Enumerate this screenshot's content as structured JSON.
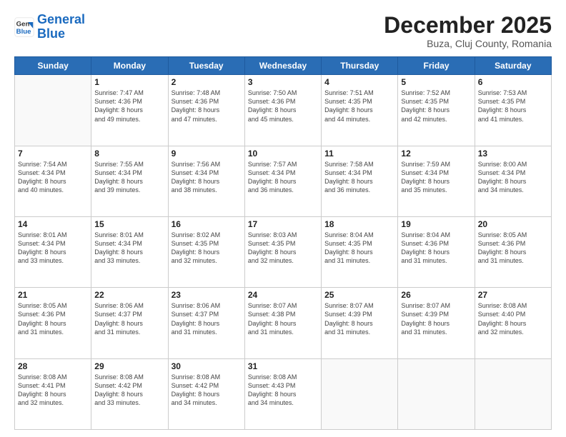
{
  "header": {
    "logo_line1": "General",
    "logo_line2": "Blue",
    "month": "December 2025",
    "location": "Buza, Cluj County, Romania"
  },
  "weekdays": [
    "Sunday",
    "Monday",
    "Tuesday",
    "Wednesday",
    "Thursday",
    "Friday",
    "Saturday"
  ],
  "weeks": [
    [
      {
        "day": "",
        "info": ""
      },
      {
        "day": "1",
        "info": "Sunrise: 7:47 AM\nSunset: 4:36 PM\nDaylight: 8 hours\nand 49 minutes."
      },
      {
        "day": "2",
        "info": "Sunrise: 7:48 AM\nSunset: 4:36 PM\nDaylight: 8 hours\nand 47 minutes."
      },
      {
        "day": "3",
        "info": "Sunrise: 7:50 AM\nSunset: 4:36 PM\nDaylight: 8 hours\nand 45 minutes."
      },
      {
        "day": "4",
        "info": "Sunrise: 7:51 AM\nSunset: 4:35 PM\nDaylight: 8 hours\nand 44 minutes."
      },
      {
        "day": "5",
        "info": "Sunrise: 7:52 AM\nSunset: 4:35 PM\nDaylight: 8 hours\nand 42 minutes."
      },
      {
        "day": "6",
        "info": "Sunrise: 7:53 AM\nSunset: 4:35 PM\nDaylight: 8 hours\nand 41 minutes."
      }
    ],
    [
      {
        "day": "7",
        "info": "Sunrise: 7:54 AM\nSunset: 4:34 PM\nDaylight: 8 hours\nand 40 minutes."
      },
      {
        "day": "8",
        "info": "Sunrise: 7:55 AM\nSunset: 4:34 PM\nDaylight: 8 hours\nand 39 minutes."
      },
      {
        "day": "9",
        "info": "Sunrise: 7:56 AM\nSunset: 4:34 PM\nDaylight: 8 hours\nand 38 minutes."
      },
      {
        "day": "10",
        "info": "Sunrise: 7:57 AM\nSunset: 4:34 PM\nDaylight: 8 hours\nand 36 minutes."
      },
      {
        "day": "11",
        "info": "Sunrise: 7:58 AM\nSunset: 4:34 PM\nDaylight: 8 hours\nand 36 minutes."
      },
      {
        "day": "12",
        "info": "Sunrise: 7:59 AM\nSunset: 4:34 PM\nDaylight: 8 hours\nand 35 minutes."
      },
      {
        "day": "13",
        "info": "Sunrise: 8:00 AM\nSunset: 4:34 PM\nDaylight: 8 hours\nand 34 minutes."
      }
    ],
    [
      {
        "day": "14",
        "info": "Sunrise: 8:01 AM\nSunset: 4:34 PM\nDaylight: 8 hours\nand 33 minutes."
      },
      {
        "day": "15",
        "info": "Sunrise: 8:01 AM\nSunset: 4:34 PM\nDaylight: 8 hours\nand 33 minutes."
      },
      {
        "day": "16",
        "info": "Sunrise: 8:02 AM\nSunset: 4:35 PM\nDaylight: 8 hours\nand 32 minutes."
      },
      {
        "day": "17",
        "info": "Sunrise: 8:03 AM\nSunset: 4:35 PM\nDaylight: 8 hours\nand 32 minutes."
      },
      {
        "day": "18",
        "info": "Sunrise: 8:04 AM\nSunset: 4:35 PM\nDaylight: 8 hours\nand 31 minutes."
      },
      {
        "day": "19",
        "info": "Sunrise: 8:04 AM\nSunset: 4:36 PM\nDaylight: 8 hours\nand 31 minutes."
      },
      {
        "day": "20",
        "info": "Sunrise: 8:05 AM\nSunset: 4:36 PM\nDaylight: 8 hours\nand 31 minutes."
      }
    ],
    [
      {
        "day": "21",
        "info": "Sunrise: 8:05 AM\nSunset: 4:36 PM\nDaylight: 8 hours\nand 31 minutes."
      },
      {
        "day": "22",
        "info": "Sunrise: 8:06 AM\nSunset: 4:37 PM\nDaylight: 8 hours\nand 31 minutes."
      },
      {
        "day": "23",
        "info": "Sunrise: 8:06 AM\nSunset: 4:37 PM\nDaylight: 8 hours\nand 31 minutes."
      },
      {
        "day": "24",
        "info": "Sunrise: 8:07 AM\nSunset: 4:38 PM\nDaylight: 8 hours\nand 31 minutes."
      },
      {
        "day": "25",
        "info": "Sunrise: 8:07 AM\nSunset: 4:39 PM\nDaylight: 8 hours\nand 31 minutes."
      },
      {
        "day": "26",
        "info": "Sunrise: 8:07 AM\nSunset: 4:39 PM\nDaylight: 8 hours\nand 31 minutes."
      },
      {
        "day": "27",
        "info": "Sunrise: 8:08 AM\nSunset: 4:40 PM\nDaylight: 8 hours\nand 32 minutes."
      }
    ],
    [
      {
        "day": "28",
        "info": "Sunrise: 8:08 AM\nSunset: 4:41 PM\nDaylight: 8 hours\nand 32 minutes."
      },
      {
        "day": "29",
        "info": "Sunrise: 8:08 AM\nSunset: 4:42 PM\nDaylight: 8 hours\nand 33 minutes."
      },
      {
        "day": "30",
        "info": "Sunrise: 8:08 AM\nSunset: 4:42 PM\nDaylight: 8 hours\nand 34 minutes."
      },
      {
        "day": "31",
        "info": "Sunrise: 8:08 AM\nSunset: 4:43 PM\nDaylight: 8 hours\nand 34 minutes."
      },
      {
        "day": "",
        "info": ""
      },
      {
        "day": "",
        "info": ""
      },
      {
        "day": "",
        "info": ""
      }
    ]
  ]
}
